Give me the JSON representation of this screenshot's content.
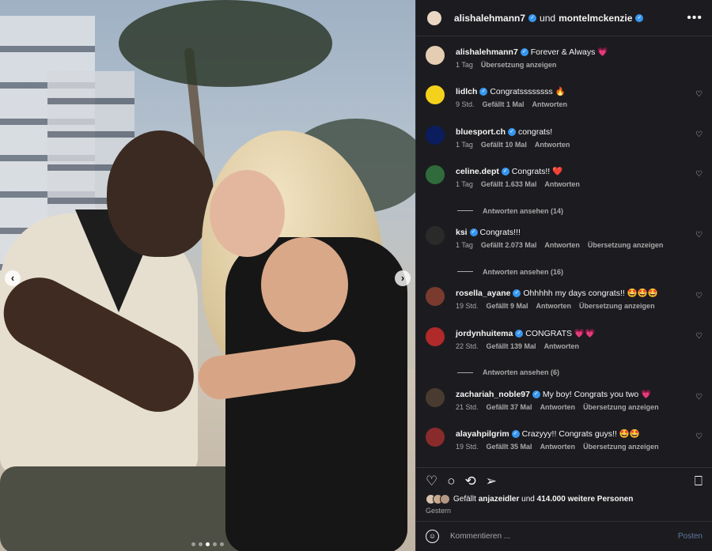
{
  "header": {
    "user1": "alishalehmann7",
    "connector": "und",
    "user2": "montelmckenzie",
    "more_icon": "more-horizontal-icon"
  },
  "colors": {
    "panel_bg": "#1c1c20",
    "verified": "#3797f0",
    "muted": "#a8a8a8",
    "heart": "#ff3b73"
  },
  "caption": {
    "user": "alishalehmann7",
    "text": "Forever & Always 💗",
    "time": "1 Tag",
    "translate": "Übersetzung anzeigen"
  },
  "comments": [
    {
      "user": "lidlch",
      "text": "Congratssssssss 🔥",
      "time": "9 Std.",
      "likes": "Gefällt 1 Mal",
      "reply": "Antworten",
      "translate": "",
      "view_replies": "",
      "avatar_color": "#f4d21c"
    },
    {
      "user": "bluesport.ch",
      "text": "congrats!",
      "time": "1 Tag",
      "likes": "Gefällt 10 Mal",
      "reply": "Antworten",
      "translate": "",
      "view_replies": "",
      "avatar_color": "#0b1d5c"
    },
    {
      "user": "celine.dept",
      "text": "Congrats!! ❤️",
      "time": "1 Tag",
      "likes": "Gefällt 1.633 Mal",
      "reply": "Antworten",
      "translate": "",
      "view_replies": "Antworten ansehen (14)",
      "avatar_color": "#2f6b3b"
    },
    {
      "user": "ksi",
      "text": "Congrats!!!",
      "time": "1 Tag",
      "likes": "Gefällt 2.073 Mal",
      "reply": "Antworten",
      "translate": "Übersetzung anzeigen",
      "view_replies": "Antworten ansehen (16)",
      "avatar_color": "#2a2a2a"
    },
    {
      "user": "rosella_ayane",
      "text": "Ohhhhh my days congrats!! 🤩🤩🤩",
      "time": "19 Std.",
      "likes": "Gefällt 9 Mal",
      "reply": "Antworten",
      "translate": "Übersetzung anzeigen",
      "view_replies": "",
      "avatar_color": "#7a3b2e"
    },
    {
      "user": "jordynhuitema",
      "text": "CONGRATS 💗💗",
      "time": "22 Std.",
      "likes": "Gefällt 139 Mal",
      "reply": "Antworten",
      "translate": "",
      "view_replies": "Antworten ansehen (6)",
      "avatar_color": "#b02a2a"
    },
    {
      "user": "zachariah_noble97",
      "text": "My boy! Congrats you two 💗",
      "time": "21 Std.",
      "likes": "Gefällt 37 Mal",
      "reply": "Antworten",
      "translate": "Übersetzung anzeigen",
      "view_replies": "",
      "avatar_color": "#4a3b30"
    },
    {
      "user": "alayahpilgrim",
      "text": "Crazyyy!! Congrats guys!! 🤩🤩",
      "time": "19 Std.",
      "likes": "Gefällt 35 Mal",
      "reply": "Antworten",
      "translate": "Übersetzung anzeigen",
      "view_replies": "",
      "avatar_color": "#8a2b2b"
    }
  ],
  "actions": {
    "like_icon": "heart-icon",
    "comment_icon": "comment-icon",
    "repost_icon": "repost-icon",
    "share_icon": "share-icon",
    "save_icon": "bookmark-icon"
  },
  "likes": {
    "prefix": "Gefällt",
    "user": "anjazeidler",
    "middle": "und",
    "count": "414.000 weitere Personen"
  },
  "date": "Gestern",
  "composer": {
    "placeholder": "Kommentieren ...",
    "post_label": "Posten",
    "emoji_icon": "emoji-icon"
  },
  "carousel": {
    "slides": 5,
    "active_slide": 3
  }
}
